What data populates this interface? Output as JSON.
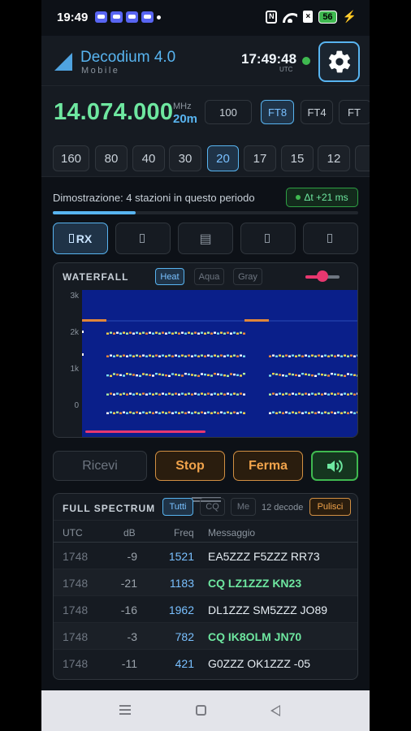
{
  "status_bar": {
    "time": "19:49",
    "battery": "56",
    "nfc": "N"
  },
  "header": {
    "title": "Decodium 4.0",
    "subtitle": "Mobile",
    "clock": "17:49:48",
    "clock_zone": "UTC"
  },
  "frequency": {
    "value": "14.074.000",
    "unit": "MHz",
    "band": "20m",
    "step": "100",
    "modes": [
      "FT8",
      "FT4",
      "FT"
    ],
    "active_mode": "FT8"
  },
  "bands": {
    "items": [
      "160",
      "80",
      "40",
      "30",
      "20",
      "17",
      "15",
      "12"
    ],
    "active": "20"
  },
  "demo": {
    "text": "Dimostrazione: 4 stazioni in questo periodo",
    "dt_label": "Δt +21 ms",
    "progress": 0.27
  },
  "tabs": {
    "rx_label": "RX",
    "icons": [
      "rx-icon",
      "tab-2-icon",
      "list-icon",
      "tab-4-icon",
      "tab-5-icon"
    ]
  },
  "waterfall": {
    "title": "WATERFALL",
    "modes": [
      "Heat",
      "Aqua",
      "Gray"
    ],
    "active_mode": "Heat",
    "gain_level": 0.5,
    "axis_labels": [
      "3k",
      "2k",
      "1k",
      "0"
    ],
    "background_color": "#0a1f8a",
    "marker_color": "#e8376f"
  },
  "actions": {
    "receive": "Ricevi",
    "stop": "Stop",
    "halt": "Ferma",
    "speaker_icon": "speaker-icon"
  },
  "spectrum": {
    "title": "FULL SPECTRUM",
    "filters": [
      "Tutti",
      "CQ",
      "Me"
    ],
    "active_filter": "Tutti",
    "count": "12 decode",
    "clear": "Pulisci",
    "columns": [
      "UTC",
      "dB",
      "Freq",
      "Messaggio"
    ],
    "rows": [
      {
        "utc": "1748",
        "db": "-9",
        "freq": "1521",
        "msg": "EA5ZZZ F5ZZZ RR73",
        "cq": false
      },
      {
        "utc": "1748",
        "db": "-21",
        "freq": "1183",
        "msg": "CQ LZ1ZZZ KN23",
        "cq": true
      },
      {
        "utc": "1748",
        "db": "-16",
        "freq": "1962",
        "msg": "DL1ZZZ SM5ZZZ JO89",
        "cq": false
      },
      {
        "utc": "1748",
        "db": "-3",
        "freq": "782",
        "msg": "CQ IK8OLM JN70",
        "cq": true
      },
      {
        "utc": "1748",
        "db": "-11",
        "freq": "421",
        "msg": "G0ZZZ OK1ZZZ -05",
        "cq": false
      }
    ]
  },
  "colors": {
    "accent": "#58b4f0",
    "freq_green": "#6ee7a0",
    "warning_orange": "#f0a34b",
    "background": "#0d1117"
  }
}
